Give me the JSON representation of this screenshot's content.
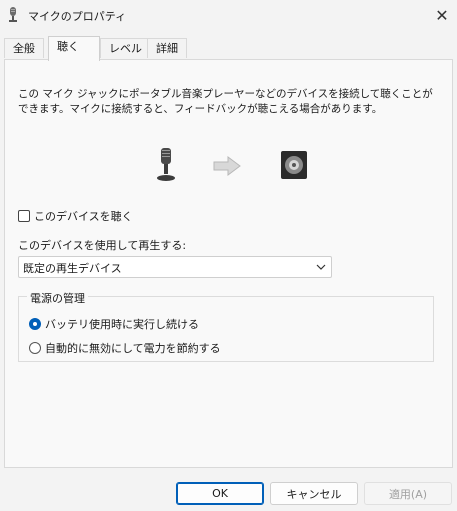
{
  "window": {
    "title": "マイクのプロパティ",
    "icon": "microphone-icon",
    "close_glyph": "✕"
  },
  "tabs": [
    {
      "label": "全般",
      "active": false
    },
    {
      "label": "聴く",
      "active": true
    },
    {
      "label": "レベル",
      "active": false
    },
    {
      "label": "詳細",
      "active": false
    }
  ],
  "description": "この マイク ジャックにポータブル音楽プレーヤーなどのデバイスを接続して聴くことができます。マイクに接続すると、フィードバックが聴こえる場合があります。",
  "listen_checkbox": {
    "label": "このデバイスを聴く",
    "checked": false
  },
  "playback": {
    "label": "このデバイスを使用して再生する:",
    "selected": "既定の再生デバイス"
  },
  "power": {
    "title": "電源の管理",
    "options": [
      {
        "label": "バッテリ使用時に実行し続ける",
        "selected": true
      },
      {
        "label": "自動的に無効にして電力を節約する",
        "selected": false
      }
    ]
  },
  "buttons": {
    "ok": "OK",
    "cancel": "キャンセル",
    "apply": "適用(A)"
  },
  "colors": {
    "accent": "#005fb8",
    "background": "#f3f3f3",
    "panel": "#f9f9f9"
  }
}
